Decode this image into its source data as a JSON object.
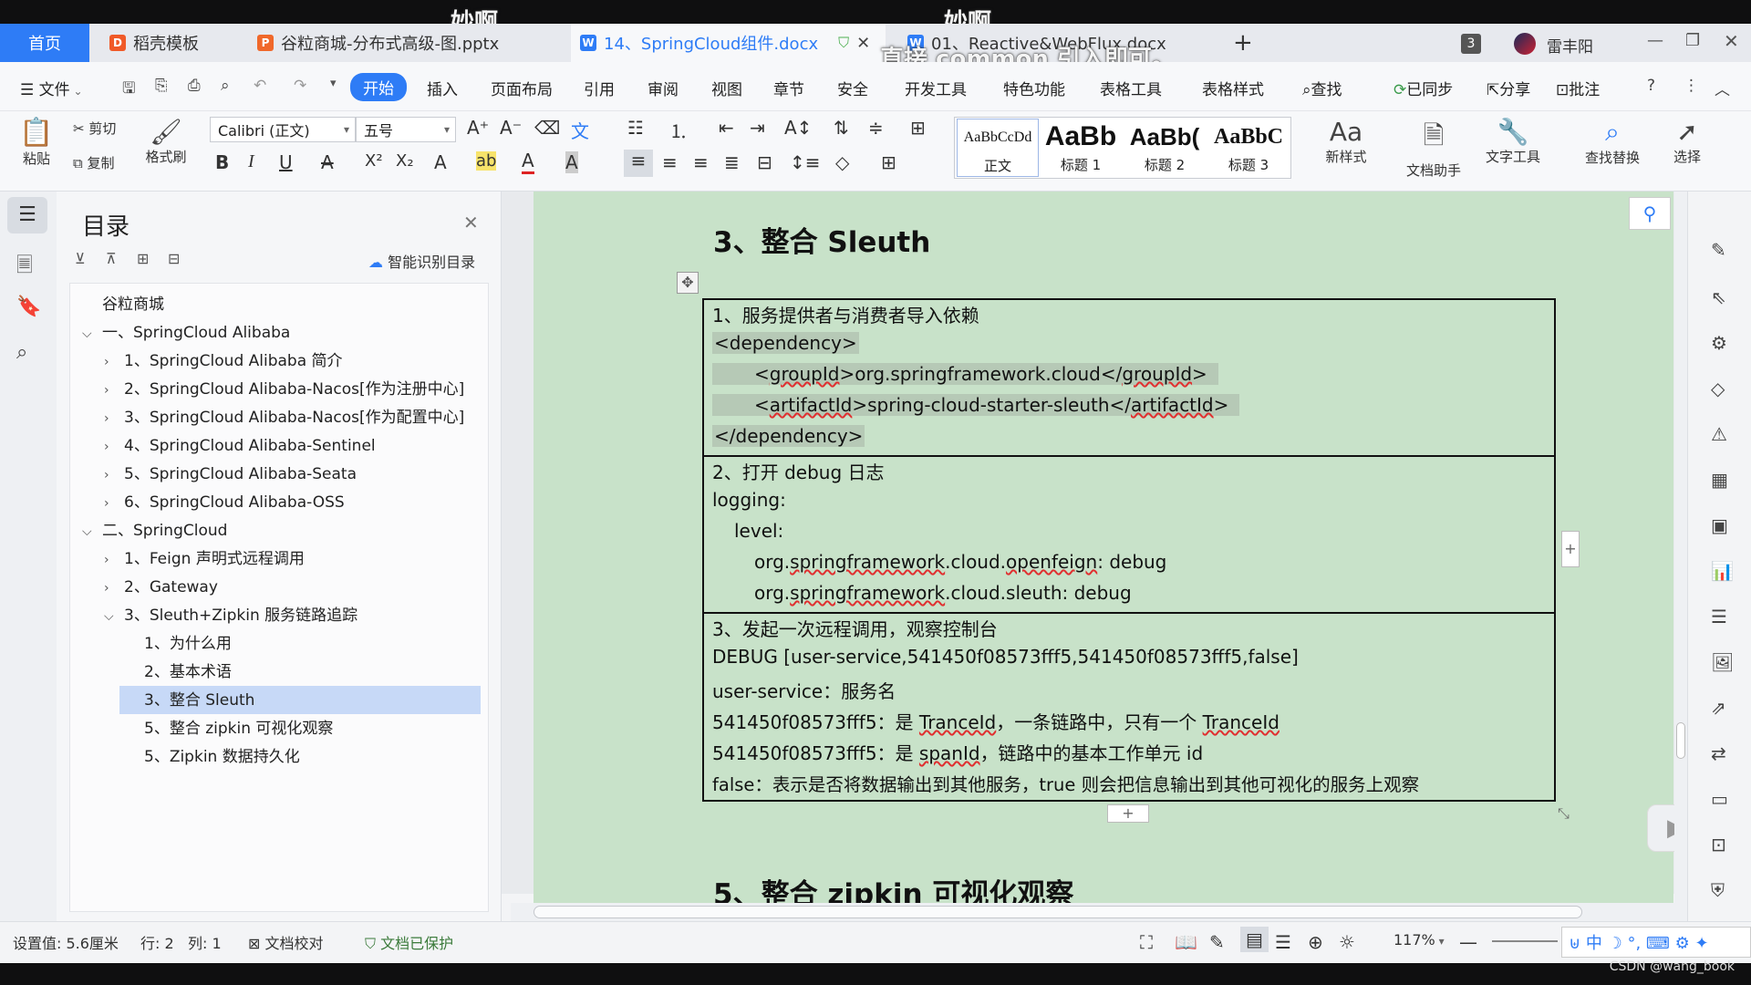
{
  "overlay": {
    "danmaku1": "妙啊",
    "danmaku2": "妙啊",
    "danmaku3": "直接 common 引入即可。"
  },
  "tabs": {
    "home": "首页",
    "t1": "稻壳模板",
    "t2": "谷粒商城-分布式高级-图.pptx",
    "t3": "14、SpringCloud组件.docx",
    "t4": "01、Reactive&WebFlux.docx",
    "badge": "3",
    "user": "雷丰阳"
  },
  "menu": {
    "file": "文件",
    "start": "开始",
    "insert": "插入",
    "layout": "页面布局",
    "ref": "引用",
    "review": "审阅",
    "view": "视图",
    "chapter": "章节",
    "security": "安全",
    "dev": "开发工具",
    "special": "特色功能",
    "tabletools": "表格工具",
    "tablestyle": "表格样式",
    "search": "查找",
    "synced": "已同步",
    "share": "分享",
    "comment": "批注"
  },
  "ribbon": {
    "paste": "粘贴",
    "cut": "剪切",
    "copy": "复制",
    "format_painter": "格式刷",
    "font_name": "Calibri (正文)",
    "font_size": "五号",
    "style_normal_sample": "AaBbCcDd",
    "style_normal": "正文",
    "style_h1_sample": "AaBb",
    "style_h1": "标题 1",
    "style_h2_sample": "AaBb(",
    "style_h2": "标题 2",
    "style_h3_sample": "AaBbC",
    "style_h3": "标题 3",
    "new_style": "新样式",
    "doc_assistant": "文档助手",
    "text_tools": "文字工具",
    "find_replace": "查找替换",
    "select": "选择"
  },
  "nav": {
    "title": "目录",
    "smart_toc": "智能识别目录",
    "items": [
      "谷粒商城",
      "一、SpringCloud Alibaba",
      "1、SpringCloud Alibaba 简介",
      "2、SpringCloud Alibaba-Nacos[作为注册中心]",
      "3、SpringCloud Alibaba-Nacos[作为配置中心]",
      "4、SpringCloud Alibaba-Sentinel",
      "5、SpringCloud Alibaba-Seata",
      "6、SpringCloud Alibaba-OSS",
      "二、SpringCloud",
      "1、Feign 声明式远程调用",
      "2、Gateway",
      "3、Sleuth+Zipkin 服务链路追踪",
      "1、为什么用",
      "2、基本术语",
      "3、整合 Sleuth",
      "5、整合 zipkin 可视化观察",
      "5、Zipkin 数据持久化"
    ]
  },
  "doc": {
    "heading": "3、整合 Sleuth",
    "heading_next": "5、整合 zipkin 可视化观察",
    "r1_title": "1、服务提供者与消费者导入依赖",
    "r1_l1": "<dependency>",
    "r1_l2a": "<",
    "r1_l2b": "groupId",
    "r1_l2c": ">org.springframework.cloud</",
    "r1_l2d": "groupId",
    "r1_l2e": ">",
    "r1_l3a": "<",
    "r1_l3b": "artifactId",
    "r1_l3c": ">spring-cloud-starter-sleuth</",
    "r1_l3d": "artifactId",
    "r1_l3e": ">",
    "r1_l4": "</dependency>",
    "r2_title": "2、打开 debug 日志",
    "r2_l1": "logging:",
    "r2_l2": "level:",
    "r2_l3a": "org.",
    "r2_l3b": "springframework",
    "r2_l3c": ".cloud.",
    "r2_l3d": "openfeign",
    "r2_l3e": ": debug",
    "r2_l4a": "org.",
    "r2_l4b": "springframework",
    "r2_l4c": ".cloud.sleuth: debug",
    "r3_title": "3、发起一次远程调用，观察控制台",
    "r3_l1": "DEBUG [user-service,541450f08573fff5,541450f08573fff5,false]",
    "r3_l2": "user-service：服务名",
    "r3_l3a": "541450f08573fff5：是 ",
    "r3_l3b": "TranceId",
    "r3_l3c": "，一条链路中，只有一个 ",
    "r3_l3d": "TranceId",
    "r3_l4a": "541450f08573fff5：是 ",
    "r3_l4b": "spanId",
    "r3_l4c": "，链路中的基本工作单元 id",
    "r3_l5": "false：表示是否将数据输出到其他服务，true 则会把信息输出到其他可视化的服务上观察"
  },
  "status": {
    "setting": "设置值: 5.6厘米",
    "row": "行: 2",
    "col": "列: 1",
    "proof": "文档校对",
    "protected": "文档已保护",
    "zoom": "117%",
    "watermark": "CSDN @wang_book"
  },
  "colors": {
    "accent": "#2e7cf6",
    "page": "#c8e2c9",
    "selected_nav": "#c7d9f7"
  }
}
